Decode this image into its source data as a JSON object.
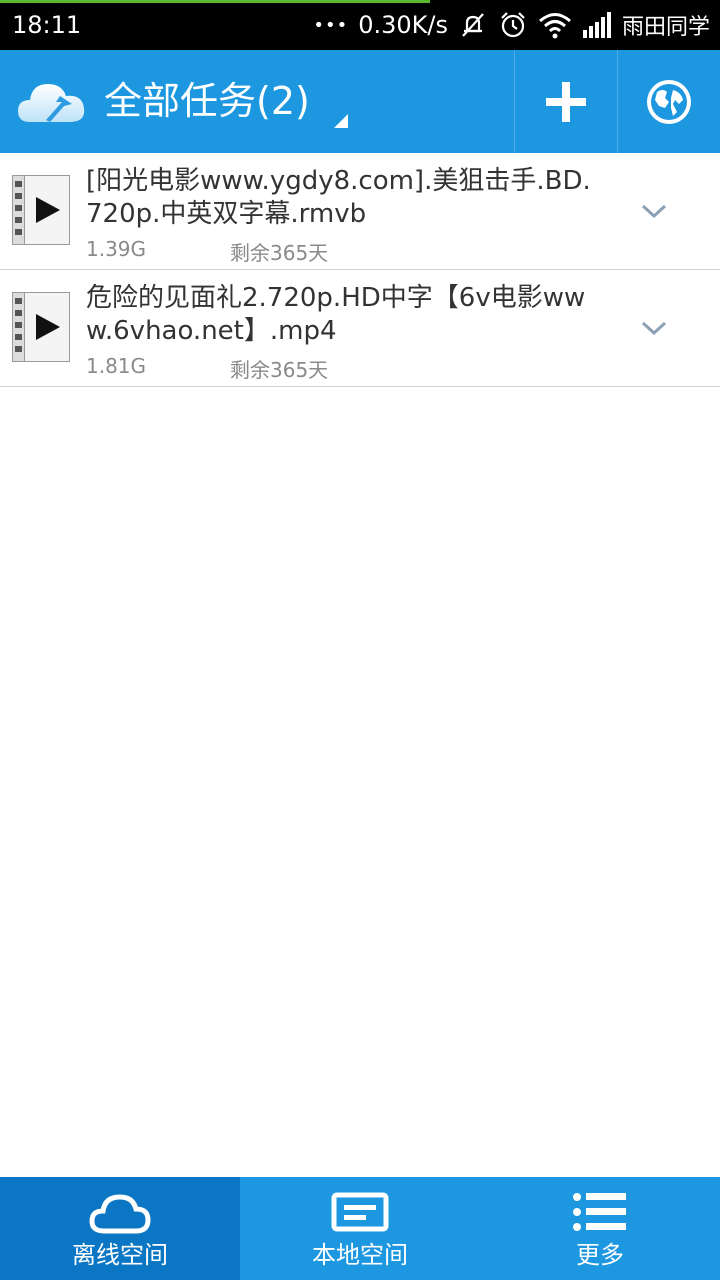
{
  "status_bar": {
    "time": "18:11",
    "dots": "•••",
    "net_speed": "0.30K/s",
    "carrier": "雨田同学"
  },
  "app_bar": {
    "title": "全部任务(2)"
  },
  "tasks": [
    {
      "name": "[阳光电影www.ygdy8.com].美狙击手.BD.720p.中英双字幕.rmvb",
      "size": "1.39G",
      "remaining": "剩余365天"
    },
    {
      "name": "危险的见面礼2.720p.HD中字【6v电影www.6vhao.net】.mp4",
      "size": "1.81G",
      "remaining": "剩余365天"
    }
  ],
  "bottom_nav": {
    "tabs": [
      {
        "label": "离线空间",
        "icon": "cloud-icon",
        "active": true
      },
      {
        "label": "本地空间",
        "icon": "local-storage-icon",
        "active": false
      },
      {
        "label": "更多",
        "icon": "list-icon",
        "active": false
      }
    ]
  },
  "colors": {
    "primary": "#1d97e0",
    "active_tab": "#0b76c3",
    "status_bar": "#000000"
  }
}
